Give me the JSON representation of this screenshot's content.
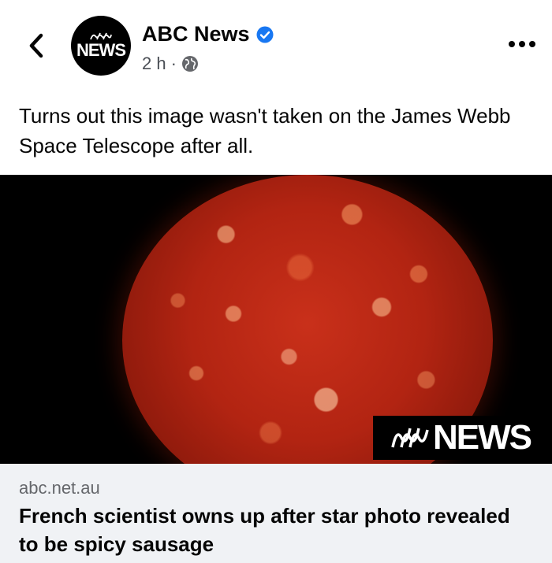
{
  "post": {
    "page_name": "ABC News",
    "avatar_text": "NEWS",
    "time": "2 h",
    "separator": "·",
    "caption": "Turns out this image wasn't taken on the James Webb Space Telescope after all."
  },
  "image": {
    "watermark_text": "NEWS"
  },
  "link_preview": {
    "domain": "abc.net.au",
    "headline": "French scientist owns up after star photo revealed to be spicy sausage"
  },
  "icons": {
    "back": "chevron-left-icon",
    "verified": "verified-badge-icon",
    "audience": "globe-icon",
    "more": "more-horizontal-icon"
  },
  "colors": {
    "verified_blue": "#1877f2",
    "meta_gray": "#4b4f56",
    "link_bg": "#f0f2f5"
  }
}
